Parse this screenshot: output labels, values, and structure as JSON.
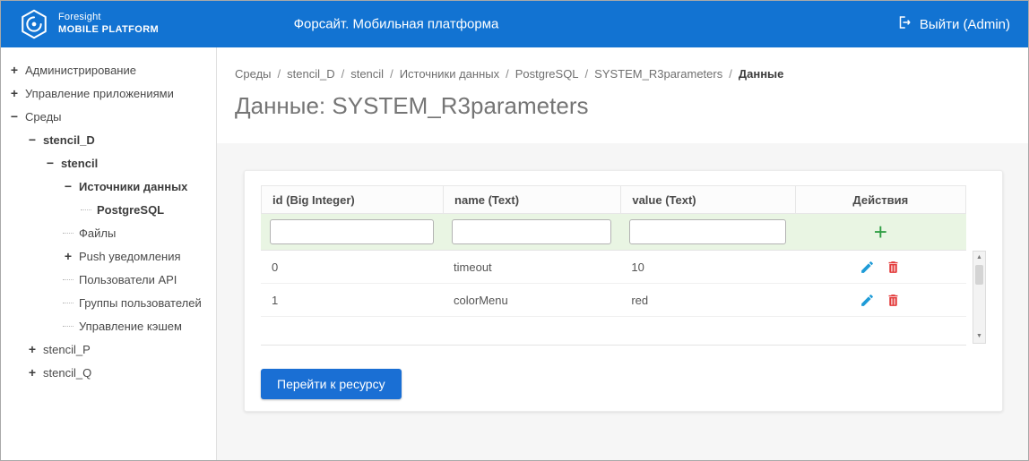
{
  "theme": {
    "header_bg": "#1273d2",
    "accent_green": "#2f9e44",
    "filter_bg": "#e9f5e3",
    "edit_blue": "#1e9bd7",
    "delete_red": "#e33b3b",
    "button_blue": "#1a6fd4"
  },
  "header": {
    "brand_line1": "Foresight",
    "brand_line2": "MOBILE PLATFORM",
    "title": "Форсайт. Мобильная платформа",
    "logout_label": "Выйти (Admin)"
  },
  "sidebar": {
    "items": [
      {
        "label": "Администрирование",
        "toggle": "+",
        "level": 0,
        "bold": false
      },
      {
        "label": "Управление приложениями",
        "toggle": "+",
        "level": 0,
        "bold": false
      },
      {
        "label": "Среды",
        "toggle": "−",
        "level": 0,
        "bold": false
      },
      {
        "label": "stencil_D",
        "toggle": "−",
        "level": 1,
        "bold": true
      },
      {
        "label": "stencil",
        "toggle": "−",
        "level": 2,
        "bold": true
      },
      {
        "label": "Источники данных",
        "toggle": "−",
        "level": 3,
        "bold": true
      },
      {
        "label": "PostgreSQL",
        "toggle": "",
        "level": 4,
        "bold": true
      },
      {
        "label": "Файлы",
        "toggle": "",
        "level": 3,
        "bold": false
      },
      {
        "label": "Push уведомления",
        "toggle": "+",
        "level": 3,
        "bold": false
      },
      {
        "label": "Пользователи API",
        "toggle": "",
        "level": 3,
        "bold": false
      },
      {
        "label": "Группы пользователей",
        "toggle": "",
        "level": 3,
        "bold": false
      },
      {
        "label": "Управление кэшем",
        "toggle": "",
        "level": 3,
        "bold": false
      },
      {
        "label": "stencil_P",
        "toggle": "+",
        "level": 1,
        "bold": false
      },
      {
        "label": "stencil_Q",
        "toggle": "+",
        "level": 1,
        "bold": false
      }
    ]
  },
  "breadcrumb": {
    "separator": "/",
    "items": [
      "Среды",
      "stencil_D",
      "stencil",
      "Источники данных",
      "PostgreSQL",
      "SYSTEM_R3parameters",
      "Данные"
    ]
  },
  "page": {
    "title": "Данные: SYSTEM_R3parameters"
  },
  "table": {
    "columns": [
      "id (Big Integer)",
      "name (Text)",
      "value (Text)",
      "Действия"
    ],
    "filter_values": [
      "",
      "",
      ""
    ],
    "add_label": "+",
    "rows": [
      {
        "id": "0",
        "name": "timeout",
        "value": "10"
      },
      {
        "id": "1",
        "name": "colorMenu",
        "value": "red"
      }
    ]
  },
  "actions": {
    "go_to_resource": "Перейти к ресурсу"
  }
}
